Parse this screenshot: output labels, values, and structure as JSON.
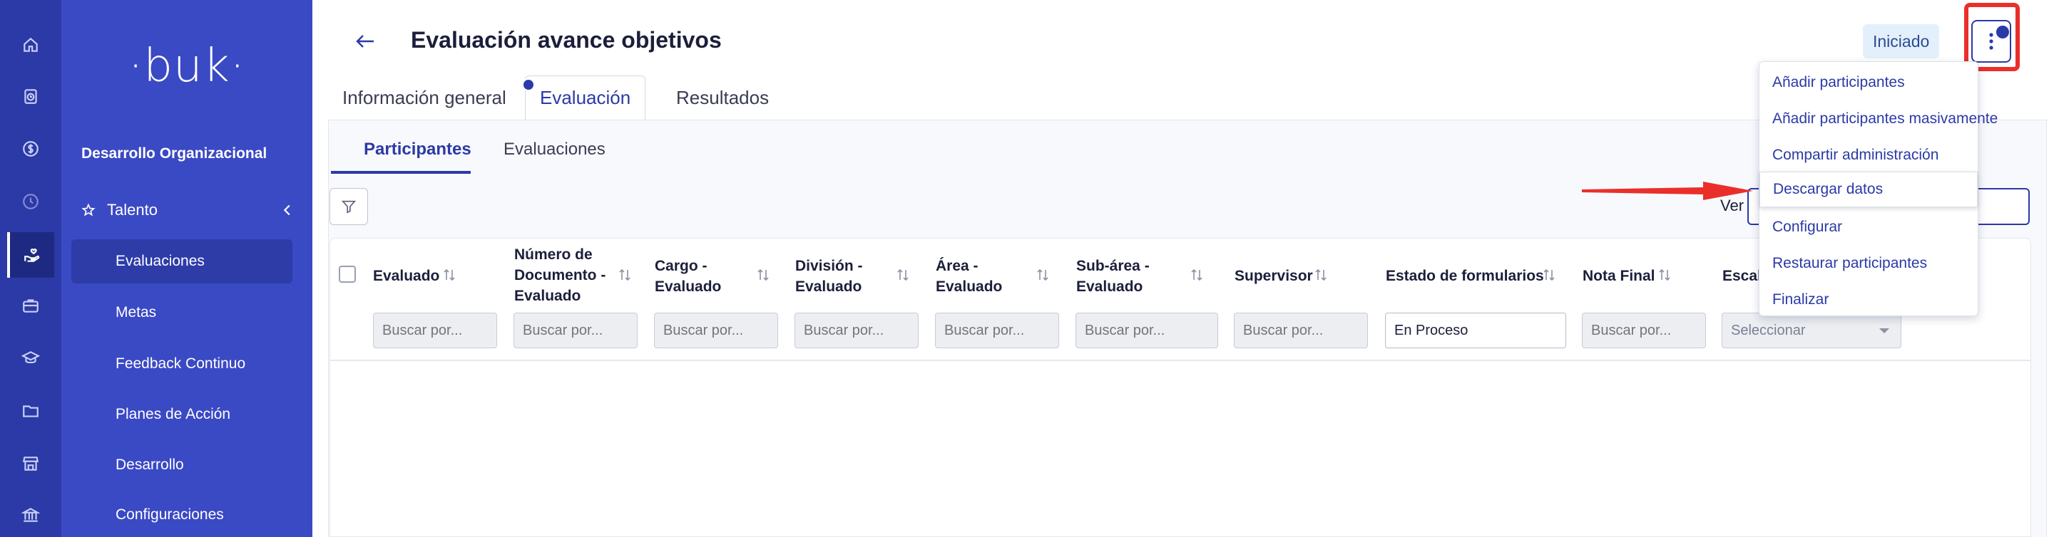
{
  "sidebar": {
    "logo": "·buk·",
    "org_title": "Desarrollo Organizacional",
    "section": "Talento",
    "items": [
      {
        "label": "Evaluaciones"
      },
      {
        "label": "Metas"
      },
      {
        "label": "Feedback Continuo"
      },
      {
        "label": "Planes de Acción"
      },
      {
        "label": "Desarrollo"
      },
      {
        "label": "Configuraciones"
      }
    ]
  },
  "header": {
    "title": "Evaluación avance objetivos",
    "status": "Iniciado"
  },
  "tabs": [
    {
      "label": "Información general"
    },
    {
      "label": "Evaluación"
    },
    {
      "label": "Resultados"
    }
  ],
  "subtabs": [
    {
      "label": "Participantes"
    },
    {
      "label": "Evaluaciones"
    }
  ],
  "ver_label": "Ver",
  "table": {
    "columns": [
      {
        "label": "Evaluado"
      },
      {
        "label": "Número de Documento - Evaluado"
      },
      {
        "label": "Cargo - Evaluado"
      },
      {
        "label": "División - Evaluado"
      },
      {
        "label": "Área - Evaluado"
      },
      {
        "label": "Sub-área - Evaluado"
      },
      {
        "label": "Supervisor"
      },
      {
        "label": "Estado de formularios"
      },
      {
        "label": "Nota Final"
      },
      {
        "label": "Escala"
      }
    ],
    "search_placeholder": "Buscar por...",
    "estado_value": "En Proceso",
    "escala_value": "Seleccionar"
  },
  "menu": {
    "items": [
      {
        "label": "Añadir participantes"
      },
      {
        "label": "Añadir participantes masivamente"
      },
      {
        "label": "Compartir administración"
      },
      {
        "label": "Descargar datos"
      },
      {
        "label": "Configurar"
      },
      {
        "label": "Restaurar participantes"
      },
      {
        "label": "Finalizar"
      }
    ]
  },
  "colors": {
    "rail": "#2b3aa6",
    "sidebar": "#3a49c4",
    "accent": "#2b3aa6",
    "annotation": "#ea2f2a"
  }
}
